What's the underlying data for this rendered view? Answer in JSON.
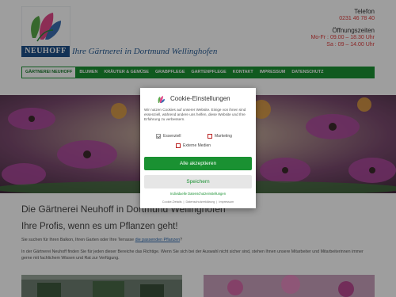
{
  "header": {
    "logo_text": "NEUHOFF",
    "tagline": "Ihre Gärtnerei in Dortmund Wellinghofen",
    "phone_label": "Telefon",
    "phone_number": "0231 46 78 40",
    "hours_label": "Öffnungszeiten",
    "hours_weekdays": "Mo-Fr : 09.00 – 18.30 Uhr",
    "hours_saturday": "Sa : 09 – 14.00 Uhr"
  },
  "nav": {
    "items": [
      {
        "label": "Gärtnerei Neuhoff"
      },
      {
        "label": "Blumen"
      },
      {
        "label": "Kräuter & Gemüse"
      },
      {
        "label": "Grabpflege"
      },
      {
        "label": "Gartenpflege"
      },
      {
        "label": "Kontakt"
      },
      {
        "label": "Impressum"
      },
      {
        "label": "Datenschutz"
      }
    ]
  },
  "content": {
    "heading": "Die Gärtnerei Neuhoff in Dortmund Wellinghofen",
    "subheading": "Ihre Profis, wenn es um Pflanzen geht!",
    "intro_text": "Sie suchen für Ihren Balkon, Ihren Garten oder Ihre Terrasse",
    "intro_link": "die passenden Pflanzen",
    "intro_end": "?",
    "paragraph": "In der Gärtnerei Neuhoff finden Sie für jeden dieser Bereiche das Richtige. Wenn Sie sich bei der Auswahl nicht sicher sind, stehen Ihnen unsere Mitarbeiter und Mitarbeiterinnen immer gerne mit fachlichem Wissen und Rat zur Verfügung."
  },
  "cookie": {
    "title": "Cookie-Einstellungen",
    "text": "Wir nutzen Cookies auf unserer Website. Einige von ihnen sind essenziell, während andere uns helfen, diese Website und Ihre Erfahrung zu verbessern.",
    "option_essential": "Essenziell",
    "option_marketing": "Marketing",
    "option_external": "Externe Medien",
    "accept_all": "Alle akzeptieren",
    "save": "Speichern",
    "individual_link": "Individuelle Datenschutzeinstellungen",
    "footer_cookie_details": "Cookie-Details",
    "footer_privacy": "Datenschutzerklärung",
    "footer_imprint": "Impressum",
    "accent_color": "#1a9132"
  }
}
